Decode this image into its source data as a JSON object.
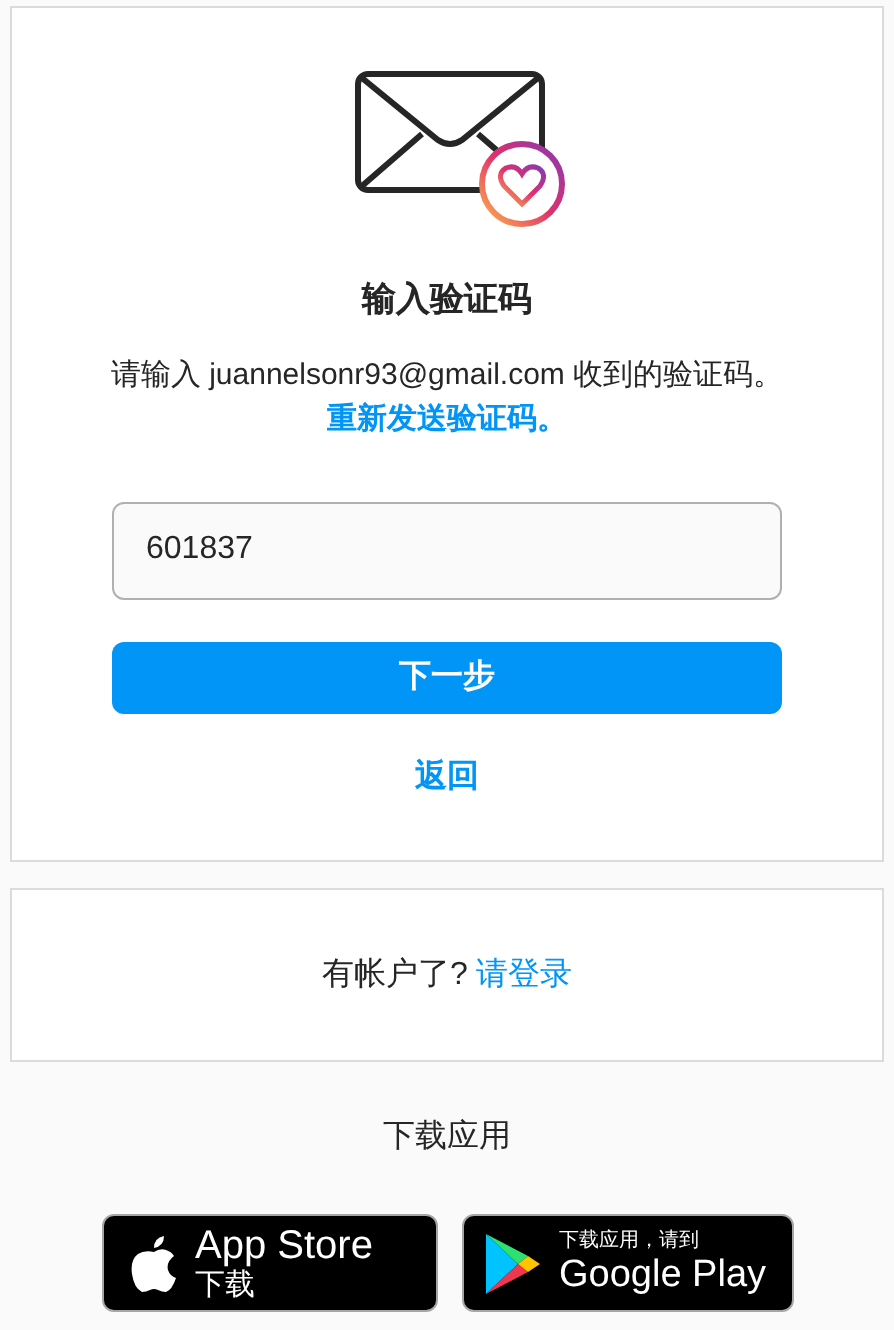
{
  "verify_card": {
    "title": "输入验证码",
    "message": "请输入 juannelsonr93@gmail.com 收到的验证码。",
    "resend_link": "重新发送验证码。",
    "code_field": {
      "value": "601837"
    },
    "next_button": "下一步",
    "back_link": "返回"
  },
  "login_card": {
    "text": "有帐户了?",
    "link": "请登录"
  },
  "download": {
    "title": "下载应用",
    "badges": [
      {
        "kind": "app_store",
        "label": "App Store",
        "sublabel": "下载"
      },
      {
        "kind": "google_play",
        "label": "Google Play",
        "sublabel": "下载应用，请到"
      }
    ]
  }
}
